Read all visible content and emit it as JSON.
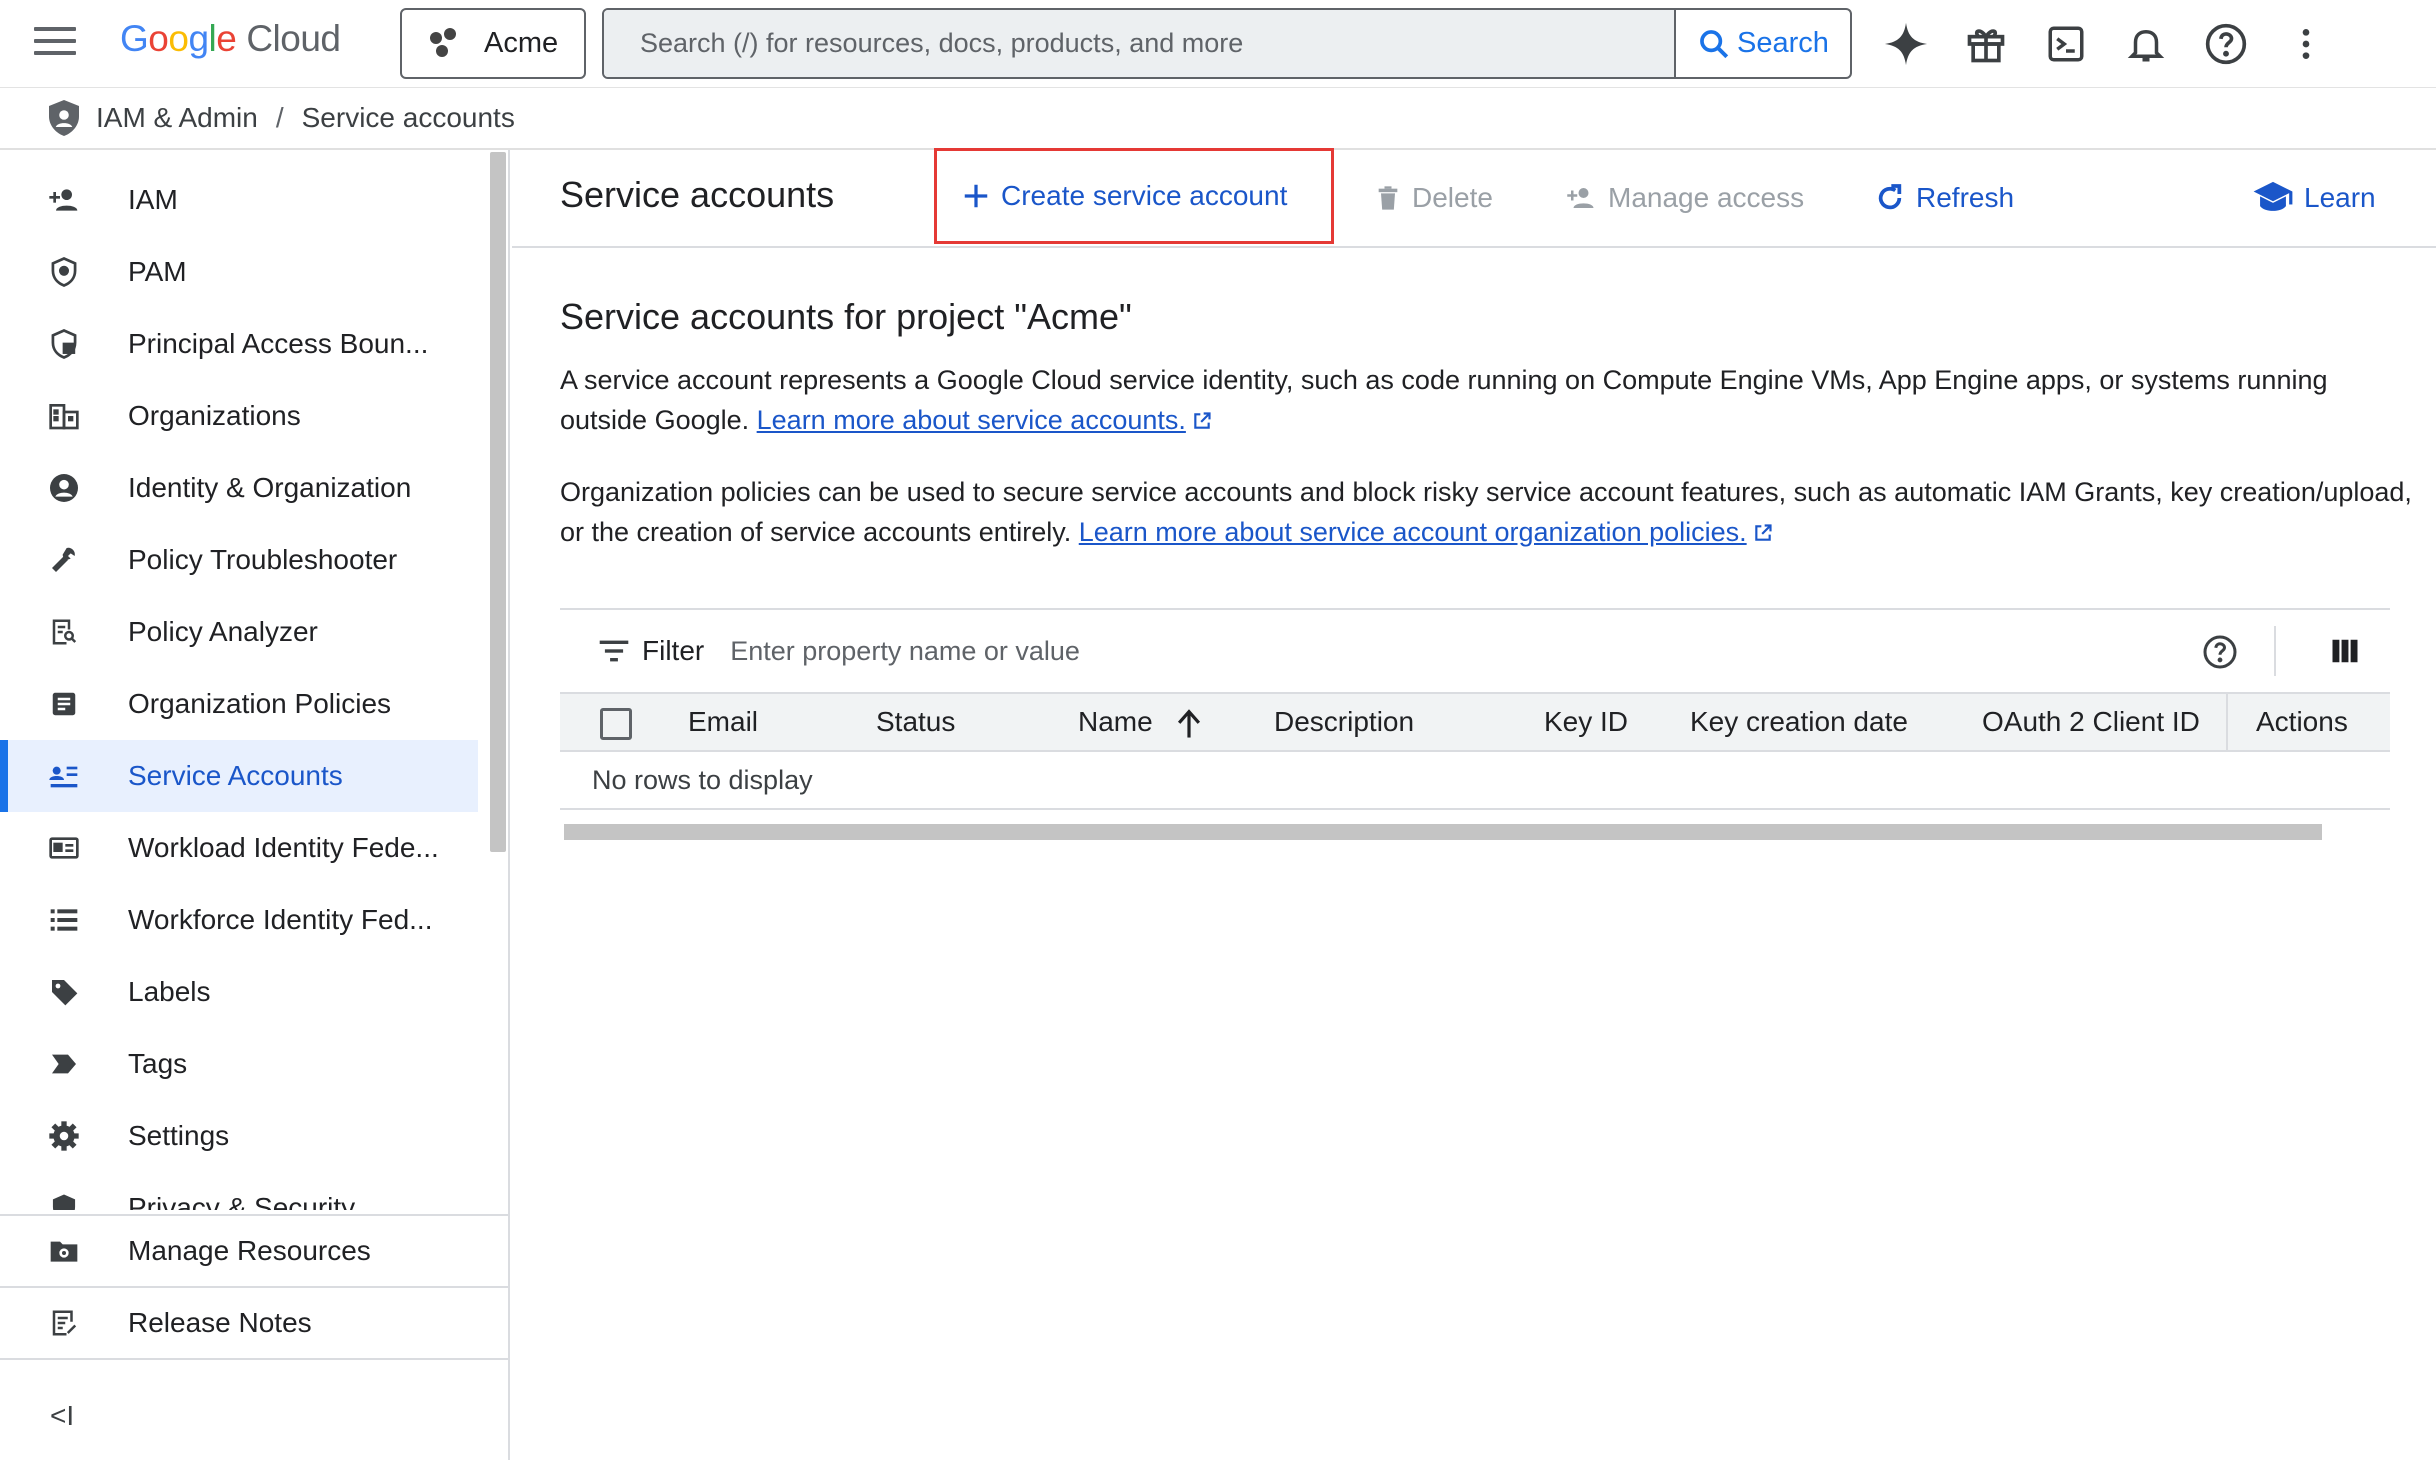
{
  "topbar": {
    "logo_google": [
      "G",
      "o",
      "o",
      "g",
      "l",
      "e"
    ],
    "logo_cloud": "Cloud",
    "project": "Acme",
    "search_placeholder": "Search (/) for resources, docs, products, and more",
    "search_button": "Search",
    "icons": [
      "gemini-sparkle-icon",
      "gift-icon",
      "cloud-shell-icon",
      "notifications-icon",
      "help-icon",
      "more-vert-icon"
    ]
  },
  "breadcrumb": {
    "parent": "IAM & Admin",
    "separator": "/",
    "current": "Service accounts"
  },
  "sidebar": {
    "items": [
      {
        "label": "IAM",
        "icon": "person-add-icon"
      },
      {
        "label": "PAM",
        "icon": "shield-icon"
      },
      {
        "label": "Principal Access Boun...",
        "icon": "shield-lock-icon"
      },
      {
        "label": "Organizations",
        "icon": "building-icon"
      },
      {
        "label": "Identity & Organization",
        "icon": "account-circle-icon"
      },
      {
        "label": "Policy Troubleshooter",
        "icon": "wrench-icon"
      },
      {
        "label": "Policy Analyzer",
        "icon": "doc-search-icon"
      },
      {
        "label": "Organization Policies",
        "icon": "policy-doc-icon"
      },
      {
        "label": "Service Accounts",
        "icon": "service-account-icon",
        "active": true
      },
      {
        "label": "Workload Identity Fede...",
        "icon": "id-card-icon"
      },
      {
        "label": "Workforce Identity Fed...",
        "icon": "list-icon"
      },
      {
        "label": "Labels",
        "icon": "label-icon"
      },
      {
        "label": "Tags",
        "icon": "tag-icon"
      },
      {
        "label": "Settings",
        "icon": "gear-icon"
      },
      {
        "label": "Privacy & Security",
        "icon": "privacy-shield-icon"
      }
    ],
    "bottom": [
      {
        "label": "Manage Resources",
        "icon": "folder-gear-icon"
      },
      {
        "label": "Release Notes",
        "icon": "notes-icon"
      }
    ],
    "collapse": "<I"
  },
  "toolbar": {
    "title": "Service accounts",
    "create": "Create service account",
    "delete": "Delete",
    "manage": "Manage access",
    "refresh": "Refresh",
    "learn": "Learn"
  },
  "content": {
    "heading": "Service accounts for project \"Acme\"",
    "p1_text": "A service account represents a Google Cloud service identity, such as code running on Compute Engine VMs, App Engine apps, or systems running outside Google. ",
    "p1_link": "Learn more about service accounts.",
    "p2_text": "Organization policies can be used to secure service accounts and block risky service account features, such as automatic IAM Grants, key creation/upload, or the creation of service accounts entirely. ",
    "p2_link": "Learn more about service account organization policies."
  },
  "table": {
    "filter_label": "Filter",
    "filter_placeholder": "Enter property name or value",
    "columns": [
      "Email",
      "Status",
      "Name",
      "Description",
      "Key ID",
      "Key creation date",
      "OAuth 2 Client ID",
      "Actions"
    ],
    "empty": "No rows to display"
  },
  "colors": {
    "accent": "#1a73e8",
    "link": "#1a56c9",
    "highlight_border": "#e53935",
    "active_bg": "#e8f0fe"
  }
}
